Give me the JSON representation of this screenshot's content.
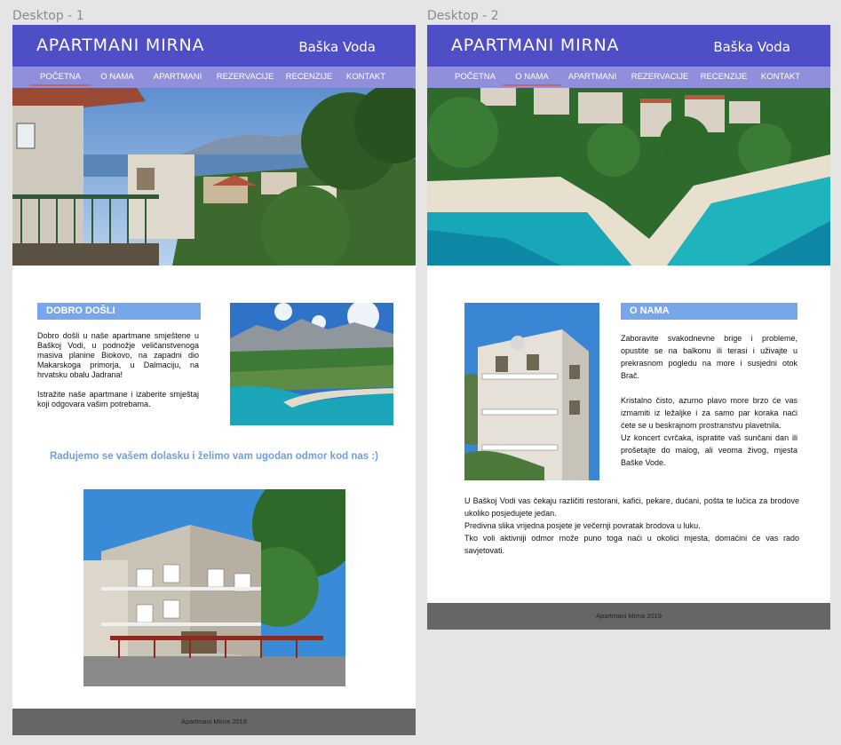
{
  "artboards": [
    {
      "label": "Desktop - 1",
      "header": {
        "brand": "APARTMANI MIRNA",
        "location": "Baška Voda"
      },
      "nav": [
        "POČETNA",
        "O NAMA",
        "APARTMANI",
        "REZERVACIJE",
        "RECENZIJE",
        "KONTAKT"
      ],
      "active_nav": "POČETNA",
      "section": {
        "title": "DOBRO DOŠLI",
        "paragraphs": [
          "Dobro došli u naše apartmane smještene u Baškoj Vodi, u podnožje veličanstvenoga masiva planine Biokovo, na zapadni dio Makarskoga primorja, u Dalmaciju, na hrvatsku obalu Jadrana!",
          "Istražite naše apartmane i izaberite smještaj koji odgovara vašim potrebama."
        ],
        "welcome": "Radujemo se vašem dolasku i želimo vam ugodan odmor kod nas :)"
      },
      "footer": "Apartmani Mirna 2019"
    },
    {
      "label": "Desktop - 2",
      "header": {
        "brand": "APARTMANI MIRNA",
        "location": "Baška Voda"
      },
      "nav": [
        "POČETNA",
        "O NAMA",
        "APARTMANI",
        "REZERVACIJE",
        "RECENZIJE",
        "KONTAKT"
      ],
      "active_nav": "O NAMA",
      "section": {
        "title": "O NAMA",
        "paragraphs": [
          "Zaboravite svakodnevne brige i probleme, opustite se na balkonu ili terasi i uživajte u prekrasnom pogledu na more i susjedni otok Brač.",
          "Kristalno čisto, azurno plavo more brzo će vas izmamiti iz ležaljke i za samo par koraka naći ćete se u beskrajnom prostranstvu plavetnila.",
          "Uz koncert cvrčaka, ispratite vaš sunčani dan ili prošetajte do malog, ali veoma živog, mjesta Baške Vode."
        ],
        "extra_paragraphs": [
          "U Baškoj Vodi vas čekaju različiti restorani, kafići, pekare, dućani, pošta te lučica za brodove ukoliko posjedujete jedan.",
          "Predivna slika vrijedna posjete je večernji povratak brodova u luku.",
          "Tko voli aktivniji odmor može puno toga naći u okolici mjesta, domaćini će vas rado savjetovati."
        ]
      },
      "footer": "Apartmani Mirna 2019"
    }
  ],
  "colors": {
    "header": "#4e4fc7",
    "nav": "#8f8fdc",
    "accent_underline": "#c76464",
    "section_label": "#78a6ea",
    "welcome_text": "#6d9fe4",
    "footer": "#666666",
    "canvas": "#e5e5e5"
  }
}
